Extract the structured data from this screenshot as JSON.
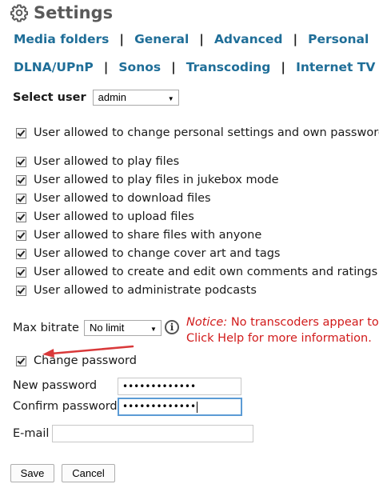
{
  "header": {
    "title": "Settings",
    "icon": "gear-icon"
  },
  "nav": {
    "row1": [
      "Media folders",
      "General",
      "Advanced",
      "Personal"
    ],
    "row2": [
      "DLNA/UPnP",
      "Sonos",
      "Transcoding",
      "Internet TV"
    ],
    "separator": "|",
    "link_color": "#1f6e98"
  },
  "select_user": {
    "label": "Select user",
    "value": "admin"
  },
  "permissions": {
    "personal": "User allowed to change personal settings and own password",
    "items": [
      "User allowed to play files",
      "User allowed to play files in jukebox mode",
      "User allowed to download files",
      "User allowed to upload files",
      "User allowed to share files with anyone",
      "User allowed to change cover art and tags",
      "User allowed to create and edit own comments and ratings",
      "User allowed to administrate podcasts"
    ]
  },
  "bitrate": {
    "label": "Max bitrate",
    "value": "No limit",
    "info_icon": "info-icon",
    "notice_label": "Notice:",
    "notice_text": " No transcoders appear to b",
    "notice_line2": "Click Help for more information.",
    "notice_color": "#d11a1a"
  },
  "change_password": {
    "label": "Change password",
    "checked": true,
    "annotation_color": "#d9393a"
  },
  "form": {
    "new_password_label": "New password",
    "new_password_value": "•••••••••••••",
    "confirm_password_label": "Confirm password",
    "confirm_password_value": "•••••••••••••",
    "email_label": "E-mail",
    "email_value": ""
  },
  "buttons": {
    "save": "Save",
    "cancel": "Cancel"
  }
}
